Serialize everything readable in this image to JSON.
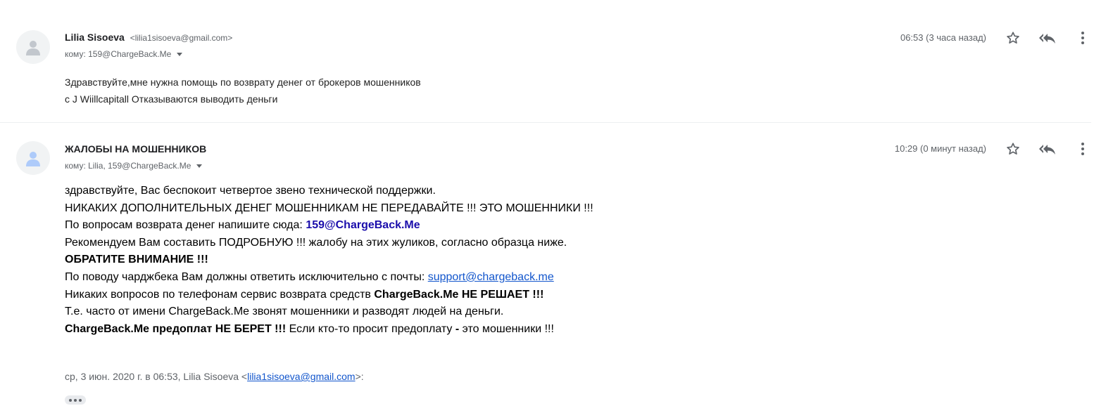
{
  "clipped_header": "— · · · ·",
  "messages": [
    {
      "sender_name": "Lilia Sisoeva",
      "sender_email": "<lilia1sisoeva@gmail.com>",
      "to": "кому: 159@ChargeBack.Me",
      "time": "06:53 (3 часа назад)",
      "body": [
        "Здравствуйте,мне нужна помощь по возврату денег от брокеров мошенников",
        "с J Wiillcapitall Отказываются выводить деньги"
      ]
    },
    {
      "sender_name": "ЖАЛОБЫ НА МОШЕННИКОВ",
      "to": "кому: Lilia, 159@ChargeBack.Me",
      "time": "10:29 (0 минут назад)",
      "body": {
        "l1": "здравствуйте, Вас беспокоит четвертое звено технической поддержки.",
        "l2": "НИКАКИХ ДОПОЛНИТЕЛЬНЫХ ДЕНЕГ МОШЕННИКАМ НЕ ПЕРЕДАВАЙТЕ !!! ЭТО МОШЕННИКИ !!!",
        "l3_text": "По вопросам возврата денег напишите сюда: ",
        "l3_link": "159@ChargeBack.Me",
        "l4": "Рекомендуем Вам составить ПОДРОБНУЮ !!! жалобу на этих жуликов, согласно образца ниже.",
        "l5": "ОБРАТИТЕ ВНИМАНИЕ !!!",
        "l6_text": "По поводу чарджбека Вам должны ответить исключительно с почты: ",
        "l6_link": "support@chargeback.me",
        "l7_text": "Никаких вопросов по телефонам сервис возврата средств ",
        "l7_bold": "ChargeBack.Me НЕ РЕШАЕТ !!!",
        "l8": "Т.е. часто от имени ChargeBack.Me звонят мошенники и разводят людей на деньги.",
        "l9_bold1": "ChargeBack.Me предоплат НЕ БЕРЕТ !!!",
        "l9_text1": " Если кто-то просит предоплату ",
        "l9_bold2": "-",
        "l9_text2": " это мошенники !!!"
      },
      "quote_prefix": "ср, 3 июн. 2020 г. в 06:53, Lilia Sisoeva <",
      "quote_email": "lilia1sisoeva@gmail.com",
      "quote_suffix": ">:"
    }
  ],
  "icons": {
    "avatar": "person-icon",
    "star": "star-icon",
    "reply": "reply-all-icon",
    "more": "more-vertical-icon",
    "caret": "chevron-down-icon",
    "trimmed": "ellipsis-icon"
  },
  "colors": {
    "link_bold": "#1a0dab",
    "link": "#1155cc",
    "meta": "#5f6368",
    "avatar_bg": "#f1f3f4",
    "avatar_glyph": "#c2c7cd"
  }
}
